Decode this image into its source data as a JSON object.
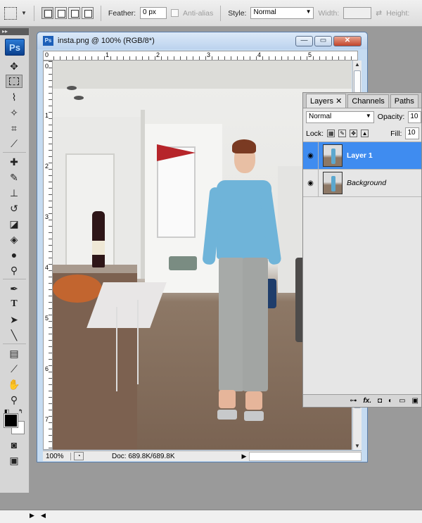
{
  "options_bar": {
    "feather_label": "Feather:",
    "feather_value": "0 px",
    "antialias_label": "Anti-alias",
    "style_label": "Style:",
    "style_value": "Normal",
    "width_label": "Width:",
    "height_label": "Height:"
  },
  "tools_panel": {
    "logo": "Ps",
    "collapse_glyph": "▸▸"
  },
  "document": {
    "title": "insta.png @ 100% (RGB/8*)",
    "zoom": "100%",
    "doc_info": "Doc: 689.8K/689.8K",
    "ruler_h": [
      "0",
      "1",
      "2",
      "3",
      "4",
      "5"
    ],
    "ruler_v": [
      "0",
      "1",
      "2",
      "3",
      "4",
      "5",
      "6",
      "7"
    ]
  },
  "layers_panel": {
    "tabs": [
      "Layers",
      "Channels",
      "Paths"
    ],
    "blend_mode": "Normal",
    "opacity_label": "Opacity:",
    "opacity_value": "10",
    "lock_label": "Lock:",
    "fill_label": "Fill:",
    "fill_value": "10",
    "layers": [
      {
        "name": "Layer 1",
        "selected": true
      },
      {
        "name": "Background",
        "selected": false
      }
    ],
    "footer_icons": [
      "link-icon",
      "fx-icon",
      "mask-icon",
      "adjustment-icon",
      "folder-icon",
      "new-layer-icon"
    ]
  },
  "colors": {
    "foreground": "#000000",
    "background": "#ffffff",
    "selection_highlight": "#3f8cf0"
  }
}
